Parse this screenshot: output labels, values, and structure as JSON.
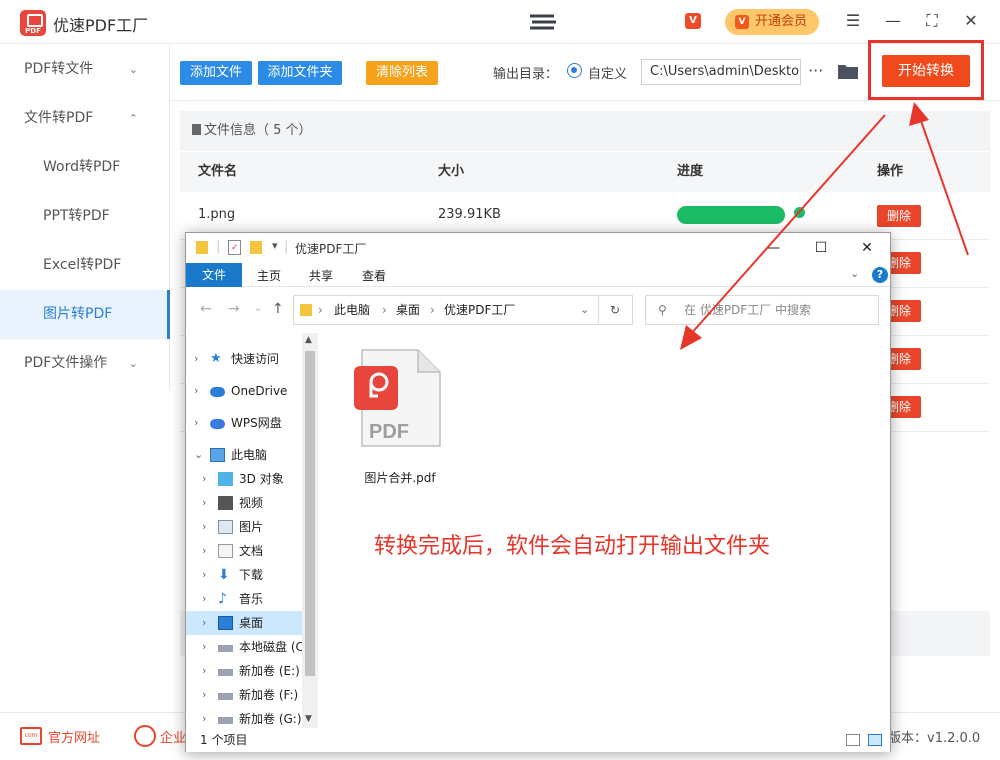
{
  "app": {
    "title": "优速PDF工厂",
    "logo_text": "PDF",
    "vip_label": "开通会员",
    "vip_badge": "V"
  },
  "window_controls": [
    "menu-icon",
    "minimize-icon",
    "maximize-icon",
    "close-icon"
  ],
  "sidebar": {
    "items": [
      {
        "label": "PDF转文件",
        "type": "group",
        "expanded": false
      },
      {
        "label": "文件转PDF",
        "type": "group",
        "expanded": true
      },
      {
        "label": "Word转PDF",
        "type": "sub"
      },
      {
        "label": "PPT转PDF",
        "type": "sub"
      },
      {
        "label": "Excel转PDF",
        "type": "sub"
      },
      {
        "label": "图片转PDF",
        "type": "sub",
        "active": true
      },
      {
        "label": "PDF文件操作",
        "type": "group",
        "expanded": false
      }
    ]
  },
  "toolbar": {
    "add_file": "添加文件",
    "add_folder": "添加文件夹",
    "clear_list": "清除列表",
    "output_label": "输出目录：",
    "custom_label": "自定义",
    "output_path": "C:\\Users\\admin\\Desktop",
    "more": "···",
    "start": "开始转换"
  },
  "file_info": {
    "label": "文件信息（ 5 个）"
  },
  "table": {
    "headers": {
      "name": "文件名",
      "size": "大小",
      "progress": "进度",
      "action": "操作"
    },
    "rows": [
      {
        "name": "1.png",
        "size": "239.91KB",
        "progress": 1.0,
        "action": "删除"
      },
      {
        "action": "删除"
      },
      {
        "action": "删除"
      },
      {
        "action": "删除"
      },
      {
        "action": "删除"
      }
    ]
  },
  "explorer": {
    "title": "优速PDF工厂",
    "tabs": {
      "file": "文件",
      "home": "主页",
      "share": "共享",
      "view": "查看"
    },
    "address": {
      "pc": "此电脑",
      "desktop": "桌面",
      "folder": "优速PDF工厂"
    },
    "search_placeholder": "在 优速PDF工厂 中搜索",
    "tree": [
      {
        "label": "快速访问",
        "icon": "star-icon",
        "level": 0
      },
      {
        "label": "OneDrive",
        "icon": "cloud-icon",
        "level": 0
      },
      {
        "label": "WPS网盘",
        "icon": "cloud-icon",
        "level": 0
      },
      {
        "label": "此电脑",
        "icon": "computer-icon",
        "level": 0,
        "expanded": true
      },
      {
        "label": "3D 对象",
        "icon": "cube-icon",
        "level": 1
      },
      {
        "label": "视频",
        "icon": "video-icon",
        "level": 1
      },
      {
        "label": "图片",
        "icon": "picture-icon",
        "level": 1
      },
      {
        "label": "文档",
        "icon": "document-icon",
        "level": 1
      },
      {
        "label": "下载",
        "icon": "download-icon",
        "level": 1
      },
      {
        "label": "音乐",
        "icon": "music-icon",
        "level": 1
      },
      {
        "label": "桌面",
        "icon": "desktop-icon",
        "level": 1,
        "selected": true
      },
      {
        "label": "本地磁盘 (C:)",
        "icon": "drive-icon",
        "level": 1
      },
      {
        "label": "新加卷 (E:)",
        "icon": "drive-icon",
        "level": 1
      },
      {
        "label": "新加卷 (F:)",
        "icon": "drive-icon",
        "level": 1
      },
      {
        "label": "新加卷 (G:)",
        "icon": "drive-icon",
        "level": 1
      }
    ],
    "file": {
      "name": "图片合并.pdf",
      "icon_text": "PDF"
    },
    "status": "1 个项目"
  },
  "annotation": "转换完成后，软件会自动打开输出文件夹",
  "footer": {
    "site": "官方网址",
    "qq": "企业",
    "version": "版本：v1.2.0.0"
  },
  "colors": {
    "primary": "#2b7fd8",
    "accent": "#f04a1c",
    "progress": "#1cbb65",
    "annotation": "#e8352a"
  }
}
